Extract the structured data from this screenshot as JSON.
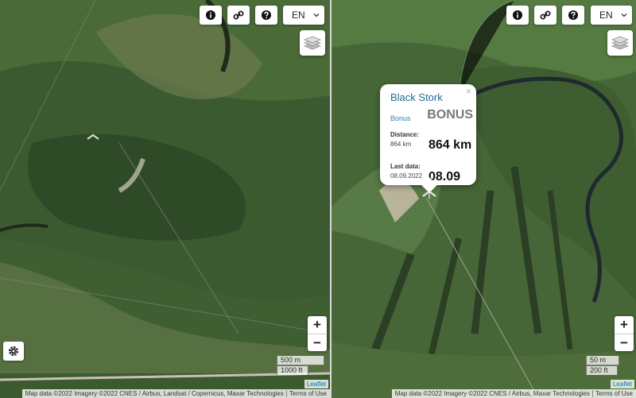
{
  "maps": {
    "left": {
      "language": "EN",
      "scale": {
        "metric": "500 m",
        "imperial": "1000 ft"
      },
      "attribution": {
        "text": "Map data ©2022 Imagery ©2022 CNES / Airbus, Landsat / Copernicus, Maxar Technologies",
        "terms": "Terms of Use",
        "leaflet": "Leaflet"
      }
    },
    "right": {
      "language": "EN",
      "scale": {
        "metric": "50 m",
        "imperial": "200 ft"
      },
      "attribution": {
        "text": "Map data ©2022 Imagery ©2022 CNES / Airbus, Maxar Technologies",
        "terms": "Terms of Use",
        "leaflet": "Leaflet"
      },
      "popup": {
        "close": "×",
        "name": "Black Stork",
        "bonus_small": "Bonus",
        "bonus_big": "BONUS",
        "distance_label": "Distance:",
        "distance_value": "864 km",
        "distance_big": "864 km",
        "last_data_label": "Last data:",
        "last_data_value": "08.09.2022",
        "last_data_big": "08.09"
      }
    }
  },
  "zoom": {
    "in": "+",
    "out": "−"
  },
  "icons": [
    "info-icon",
    "link-icon",
    "help-icon",
    "chevron-down-icon",
    "layers-icon",
    "gear-icon",
    "bird-marker-icon"
  ],
  "colors": {
    "terrain_dark": "#2f4a26",
    "terrain_mid": "#4e6b3a",
    "terrain_light": "#7a8f5e",
    "river": "#1f2a2e",
    "link_blue": "#2b80b9"
  }
}
